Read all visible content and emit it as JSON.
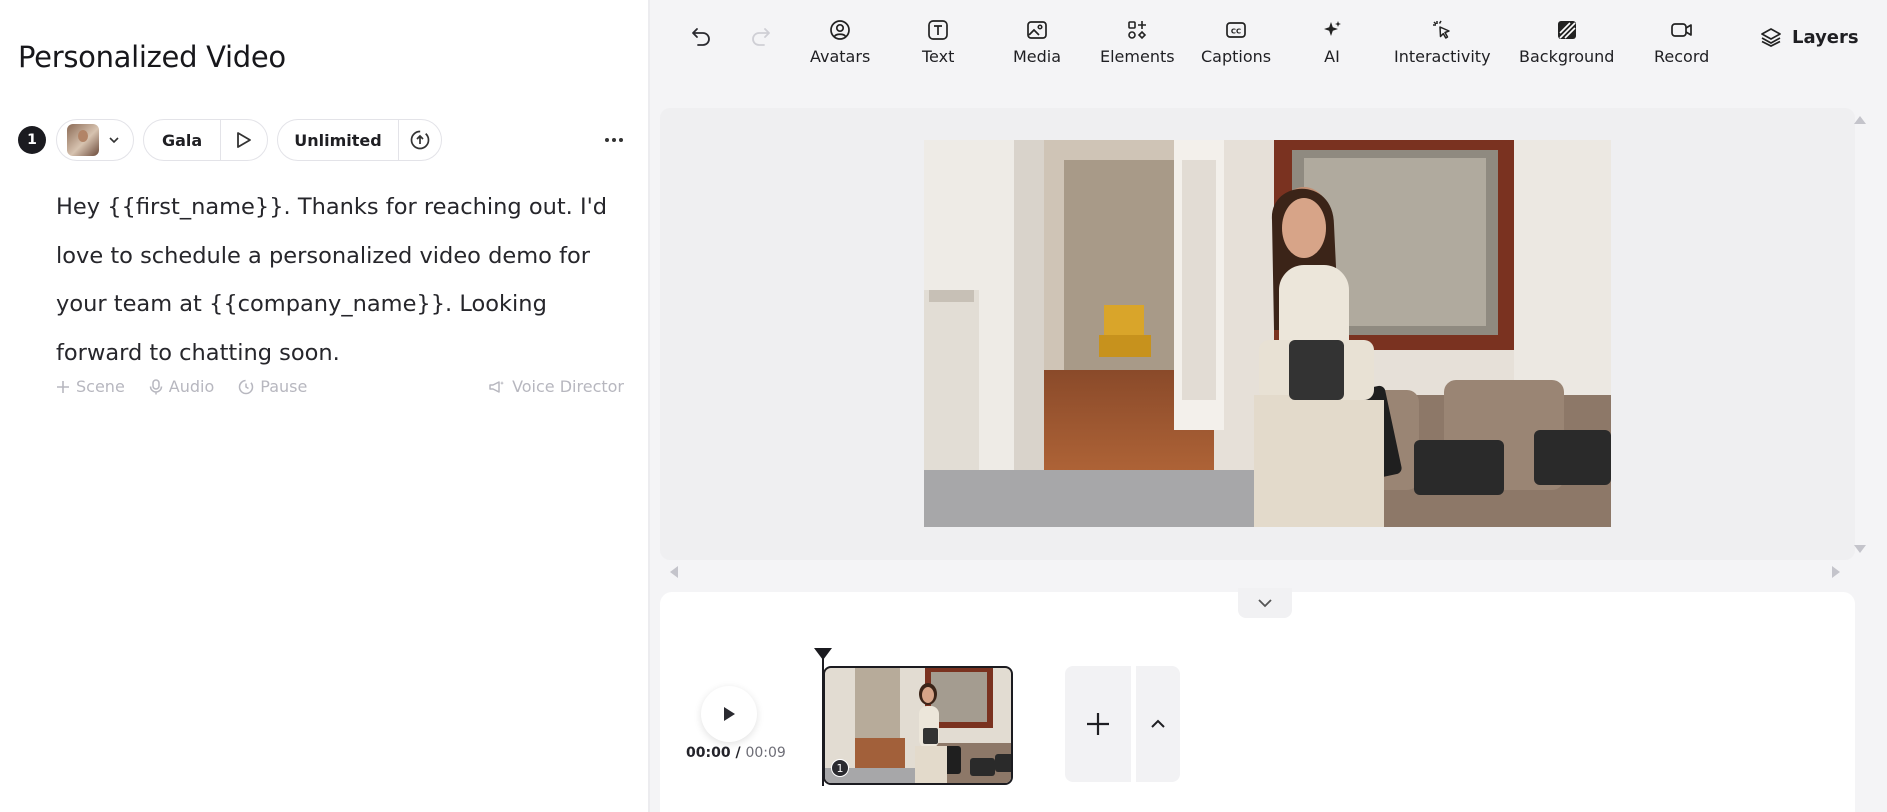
{
  "project": {
    "title": "Personalized Video"
  },
  "scene": {
    "number": "1",
    "voice_name": "Gala",
    "speed_label": "Unlimited",
    "script": "Hey {{first_name}}. Thanks for reaching out. I'd love to schedule a personalized video demo for your team at {{company_name}}. Looking forward to chatting soon.",
    "actions": {
      "scene": "Scene",
      "audio": "Audio",
      "pause": "Pause",
      "voice_director": "Voice Director"
    }
  },
  "toolbar": {
    "tools": [
      {
        "label": "Avatars",
        "icon": "avatar-icon"
      },
      {
        "label": "Text",
        "icon": "text-icon"
      },
      {
        "label": "Media",
        "icon": "media-icon"
      },
      {
        "label": "Elements",
        "icon": "elements-icon"
      },
      {
        "label": "Captions",
        "icon": "captions-icon"
      },
      {
        "label": "AI",
        "icon": "sparkle-icon"
      },
      {
        "label": "Interactivity",
        "icon": "cursor-click-icon"
      },
      {
        "label": "Background",
        "icon": "background-icon"
      },
      {
        "label": "Record",
        "icon": "video-camera-icon"
      }
    ],
    "layers_label": "Layers"
  },
  "timeline": {
    "current_time": "00:00",
    "separator": " / ",
    "total_time": "00:09",
    "clip_number": "1"
  }
}
